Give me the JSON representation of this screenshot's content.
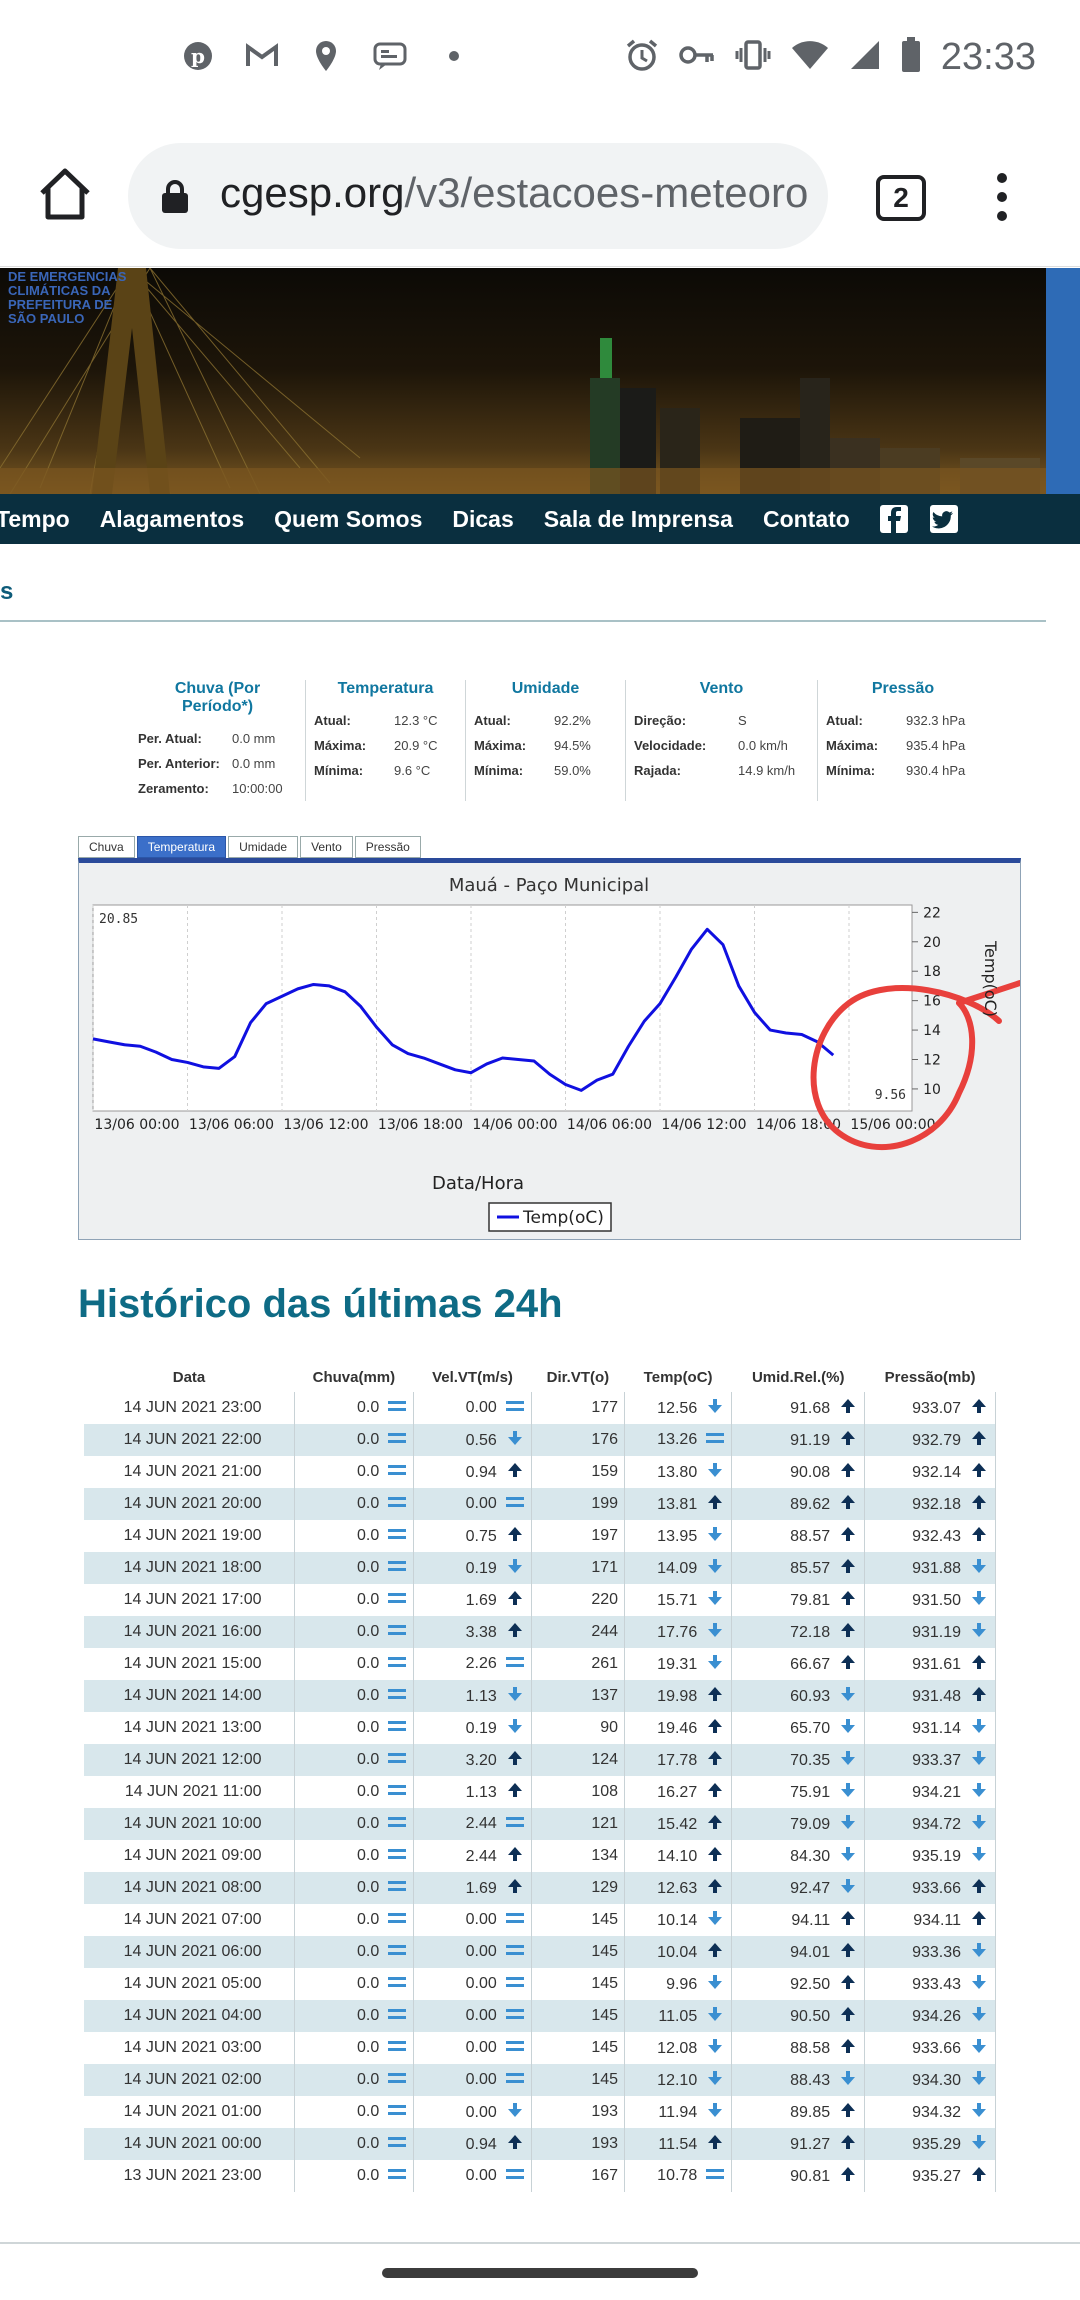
{
  "status_bar": {
    "time": "23:33",
    "left_icons": [
      "pinterest-icon",
      "gmail-icon",
      "location-icon",
      "message-icon",
      "dot-icon"
    ],
    "right_icons": [
      "alarm-icon",
      "key-icon",
      "vibrate-icon",
      "wifi-icon",
      "signal-icon",
      "battery-icon"
    ]
  },
  "browser": {
    "url_domain": "cgesp.org",
    "url_path": "/v3/estacoes-meteoro",
    "tab_count": "2"
  },
  "hero": {
    "logo_text": "DE EMERGENCIAS CLIMÁTICAS DA PREFEITURA DE SÃO PAULO"
  },
  "nav": {
    "items": [
      "Tempo",
      "Alagamentos",
      "Quem Somos",
      "Dicas",
      "Sala de Imprensa",
      "Contato"
    ]
  },
  "section_tab": "s",
  "summary": {
    "chuva": {
      "title": "Chuva (Por Período*)",
      "rows": [
        [
          "Per. Atual:",
          "0.0 mm"
        ],
        [
          "Per. Anterior:",
          "0.0 mm"
        ],
        [
          "Zeramento:",
          "10:00:00"
        ]
      ]
    },
    "temperatura": {
      "title": "Temperatura",
      "rows": [
        [
          "Atual:",
          "12.3 °C"
        ],
        [
          "Máxima:",
          "20.9 °C"
        ],
        [
          "Mínima:",
          "9.6 °C"
        ]
      ]
    },
    "umidade": {
      "title": "Umidade",
      "rows": [
        [
          "Atual:",
          "92.2%"
        ],
        [
          "Máxima:",
          "94.5%"
        ],
        [
          "Mínima:",
          "59.0%"
        ]
      ]
    },
    "vento": {
      "title": "Vento",
      "rows": [
        [
          "Direção:",
          "S"
        ],
        [
          "Velocidade:",
          "0.0 km/h"
        ],
        [
          "Rajada:",
          "14.9 km/h"
        ]
      ]
    },
    "pressao": {
      "title": "Pressão",
      "rows": [
        [
          "Atual:",
          "932.3 hPa"
        ],
        [
          "Máxima:",
          "935.4 hPa"
        ],
        [
          "Mínima:",
          "930.4 hPa"
        ]
      ]
    }
  },
  "chart_tabs": [
    "Chuva",
    "Temperatura",
    "Umidade",
    "Vento",
    "Pressão"
  ],
  "chart_data": {
    "type": "line",
    "title": "Mauá - Paço Municipal",
    "xlabel": "Data/Hora",
    "ylabel": "Temp(oC)",
    "ylim": [
      8.5,
      22.5
    ],
    "yticks": [
      10,
      12,
      14,
      16,
      18,
      20,
      22
    ],
    "xtick_labels": [
      "13/06 00:00",
      "13/06 06:00",
      "13/06 12:00",
      "13/06 18:00",
      "14/06 00:00",
      "14/06 06:00",
      "14/06 12:00",
      "14/06 18:00",
      "15/06 00:00"
    ],
    "max_label": "20.85",
    "min_label": "9.56",
    "legend": "top",
    "series": [
      {
        "name": "Temp(oC)",
        "color": "#1010e0",
        "x": [
          0,
          1,
          2,
          3,
          4,
          5,
          6,
          7,
          8,
          9,
          10,
          11,
          12,
          13,
          14,
          15,
          16,
          17,
          18,
          19,
          20,
          21,
          22,
          23,
          24,
          25,
          26,
          27,
          28,
          29,
          30,
          31,
          32,
          33,
          34,
          35,
          36,
          37,
          38,
          39,
          40,
          41,
          42,
          43,
          44,
          45,
          46,
          47
        ],
        "values": [
          13.4,
          13.2,
          13.0,
          12.9,
          12.5,
          12.0,
          11.8,
          11.5,
          11.4,
          12.2,
          14.5,
          15.8,
          16.3,
          16.8,
          17.1,
          17.0,
          16.6,
          15.6,
          14.2,
          13.0,
          12.4,
          12.1,
          11.7,
          11.3,
          11.1,
          11.7,
          12.1,
          12.0,
          11.9,
          11.0,
          10.3,
          9.9,
          10.6,
          11.0,
          12.9,
          14.6,
          15.8,
          17.6,
          19.5,
          20.85,
          19.8,
          17.0,
          15.2,
          14.0,
          13.8,
          13.7,
          13.2,
          12.3
        ]
      }
    ]
  },
  "history": {
    "title": "Histórico das últimas 24h",
    "headers": [
      "Data",
      "Chuva(mm)",
      "Vel.VT(m/s)",
      "Dir.VT(o)",
      "Temp(oC)",
      "Umid.Rel.(%)",
      "Pressão(mb)"
    ],
    "rows": [
      [
        "14 JUN 2021 23:00",
        "0.0",
        "eq",
        "0.00",
        "eq",
        "177",
        "12.56",
        "down",
        "91.68",
        "up",
        "933.07",
        "up"
      ],
      [
        "14 JUN 2021 22:00",
        "0.0",
        "eq",
        "0.56",
        "down",
        "176",
        "13.26",
        "eq",
        "91.19",
        "up",
        "932.79",
        "up"
      ],
      [
        "14 JUN 2021 21:00",
        "0.0",
        "eq",
        "0.94",
        "up",
        "159",
        "13.80",
        "down",
        "90.08",
        "up",
        "932.14",
        "up"
      ],
      [
        "14 JUN 2021 20:00",
        "0.0",
        "eq",
        "0.00",
        "eq",
        "199",
        "13.81",
        "up",
        "89.62",
        "up",
        "932.18",
        "up"
      ],
      [
        "14 JUN 2021 19:00",
        "0.0",
        "eq",
        "0.75",
        "up",
        "197",
        "13.95",
        "down",
        "88.57",
        "up",
        "932.43",
        "up"
      ],
      [
        "14 JUN 2021 18:00",
        "0.0",
        "eq",
        "0.19",
        "down",
        "171",
        "14.09",
        "down",
        "85.57",
        "up",
        "931.88",
        "down"
      ],
      [
        "14 JUN 2021 17:00",
        "0.0",
        "eq",
        "1.69",
        "up",
        "220",
        "15.71",
        "down",
        "79.81",
        "up",
        "931.50",
        "down"
      ],
      [
        "14 JUN 2021 16:00",
        "0.0",
        "eq",
        "3.38",
        "up",
        "244",
        "17.76",
        "down",
        "72.18",
        "up",
        "931.19",
        "down"
      ],
      [
        "14 JUN 2021 15:00",
        "0.0",
        "eq",
        "2.26",
        "eq",
        "261",
        "19.31",
        "down",
        "66.67",
        "up",
        "931.61",
        "up"
      ],
      [
        "14 JUN 2021 14:00",
        "0.0",
        "eq",
        "1.13",
        "down",
        "137",
        "19.98",
        "up",
        "60.93",
        "down",
        "931.48",
        "up"
      ],
      [
        "14 JUN 2021 13:00",
        "0.0",
        "eq",
        "0.19",
        "down",
        "90",
        "19.46",
        "up",
        "65.70",
        "down",
        "931.14",
        "down"
      ],
      [
        "14 JUN 2021 12:00",
        "0.0",
        "eq",
        "3.20",
        "up",
        "124",
        "17.78",
        "up",
        "70.35",
        "down",
        "933.37",
        "down"
      ],
      [
        "14 JUN 2021 11:00",
        "0.0",
        "eq",
        "1.13",
        "up",
        "108",
        "16.27",
        "up",
        "75.91",
        "down",
        "934.21",
        "down"
      ],
      [
        "14 JUN 2021 10:00",
        "0.0",
        "eq",
        "2.44",
        "eq",
        "121",
        "15.42",
        "up",
        "79.09",
        "down",
        "934.72",
        "down"
      ],
      [
        "14 JUN 2021 09:00",
        "0.0",
        "eq",
        "2.44",
        "up",
        "134",
        "14.10",
        "up",
        "84.30",
        "down",
        "935.19",
        "down"
      ],
      [
        "14 JUN 2021 08:00",
        "0.0",
        "eq",
        "1.69",
        "up",
        "129",
        "12.63",
        "up",
        "92.47",
        "down",
        "933.66",
        "up"
      ],
      [
        "14 JUN 2021 07:00",
        "0.0",
        "eq",
        "0.00",
        "eq",
        "145",
        "10.14",
        "down",
        "94.11",
        "up",
        "934.11",
        "up"
      ],
      [
        "14 JUN 2021 06:00",
        "0.0",
        "eq",
        "0.00",
        "eq",
        "145",
        "10.04",
        "up",
        "94.01",
        "up",
        "933.36",
        "down"
      ],
      [
        "14 JUN 2021 05:00",
        "0.0",
        "eq",
        "0.00",
        "eq",
        "145",
        "9.96",
        "down",
        "92.50",
        "up",
        "933.43",
        "down"
      ],
      [
        "14 JUN 2021 04:00",
        "0.0",
        "eq",
        "0.00",
        "eq",
        "145",
        "11.05",
        "down",
        "90.50",
        "up",
        "934.26",
        "down"
      ],
      [
        "14 JUN 2021 03:00",
        "0.0",
        "eq",
        "0.00",
        "eq",
        "145",
        "12.08",
        "down",
        "88.58",
        "up",
        "933.66",
        "down"
      ],
      [
        "14 JUN 2021 02:00",
        "0.0",
        "eq",
        "0.00",
        "eq",
        "145",
        "12.10",
        "down",
        "88.43",
        "down",
        "934.30",
        "down"
      ],
      [
        "14 JUN 2021 01:00",
        "0.0",
        "eq",
        "0.00",
        "down",
        "193",
        "11.94",
        "down",
        "89.85",
        "up",
        "934.32",
        "down"
      ],
      [
        "14 JUN 2021 00:00",
        "0.0",
        "eq",
        "0.94",
        "up",
        "193",
        "11.54",
        "up",
        "91.27",
        "up",
        "935.29",
        "down"
      ],
      [
        "13 JUN 2021 23:00",
        "0.0",
        "eq",
        "0.00",
        "eq",
        "167",
        "10.78",
        "eq",
        "90.81",
        "up",
        "935.27",
        "up"
      ]
    ]
  }
}
